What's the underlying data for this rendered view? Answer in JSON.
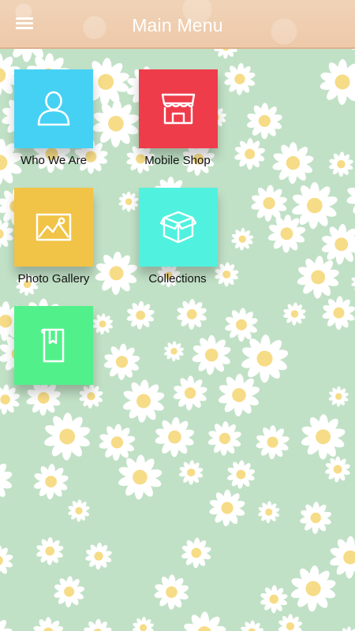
{
  "header": {
    "title": "Main Menu",
    "menu_icon": "hamburger-menu-icon"
  },
  "tiles": [
    {
      "label": "Who We Are",
      "icon": "person-icon",
      "color": "#45d1f4"
    },
    {
      "label": "Mobile Shop",
      "icon": "storefront-icon",
      "color": "#ee3c4a"
    },
    {
      "label": "Photo Gallery",
      "icon": "image-icon",
      "color": "#f1c346"
    },
    {
      "label": "Collections",
      "icon": "box-icon",
      "color": "#51f1df"
    },
    {
      "label": "",
      "icon": "book-icon",
      "color": "#52f08b"
    }
  ],
  "colors": {
    "header": "#eec9aa",
    "background": "#c1e1c6",
    "flower_petals": "#ffffff",
    "flower_center": "#f6dc87"
  }
}
